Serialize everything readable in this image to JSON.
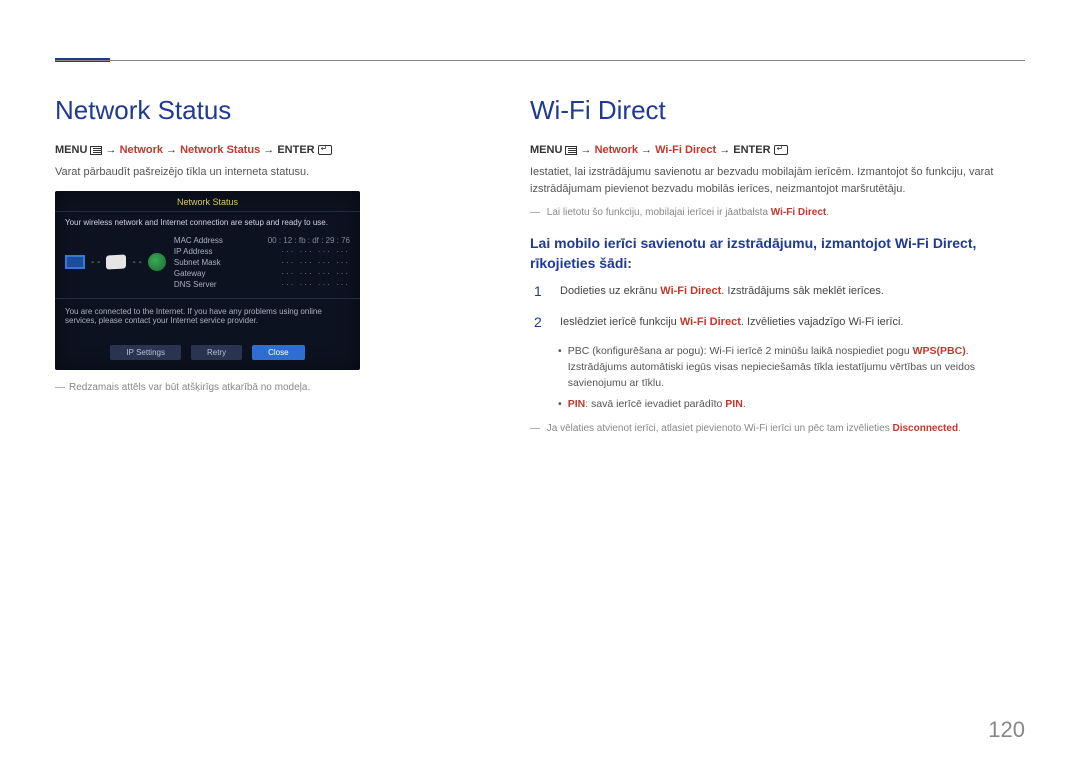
{
  "page_number": "120",
  "left": {
    "heading": "Network Status",
    "menu": {
      "prefix": "MENU",
      "path_hl": "Network",
      "sep1": "→",
      "path_hl2": "Network Status",
      "sep2": "→",
      "suffix": "ENTER"
    },
    "desc": "Varat pārbaudīt pašreizējo tīkla un interneta statusu.",
    "screenshot": {
      "title": "Network Status",
      "msg": "Your wireless network and Internet connection are setup and ready to use.",
      "rows": [
        {
          "k": "MAC Address",
          "v": "00 : 12 : fb : df : 29 : 76"
        },
        {
          "k": "IP Address",
          "v": "···   ···   ···   ···"
        },
        {
          "k": "Subnet Mask",
          "v": "···   ···   ···   ···"
        },
        {
          "k": "Gateway",
          "v": "···   ···   ···   ···"
        },
        {
          "k": "DNS Server",
          "v": "···   ···   ···   ···"
        }
      ],
      "foot": "You are connected to the Internet. If you have any problems using online services, please contact your Internet service provider.",
      "btn1": "IP Settings",
      "btn2": "Retry",
      "btn3": "Close"
    },
    "img_note": "Redzamais attēls var būt atšķirīgs atkarībā no modeļa."
  },
  "right": {
    "heading": "Wi-Fi Direct",
    "menu": {
      "prefix": "MENU",
      "path_hl": "Network",
      "sep1": "→",
      "path_hl2": "Wi-Fi Direct",
      "sep2": "→",
      "suffix": "ENTER"
    },
    "p1": "Iestatiet, lai izstrādājumu savienotu ar bezvadu mobilajām ierīcēm. Izmantojot šo funkciju, varat izstrādājumam pievienot bezvadu mobilās ierīces, neizmantojot maršrutētāju.",
    "note1_a": "Lai lietotu šo funkciju, mobilajai ierīcei ir jāatbalsta ",
    "note1_hl": "Wi-Fi Direct",
    "note1_b": ".",
    "sub": "Lai mobilo ierīci savienotu ar izstrādājumu, izmantojot Wi-Fi Direct, rīkojieties šādi:",
    "step1_a": "Dodieties uz ekrānu ",
    "step1_hl": "Wi-Fi Direct",
    "step1_b": ". Izstrādājums sāk meklēt ierīces.",
    "step2_a": "Ieslēdziet ierīcē funkciju ",
    "step2_hl": "Wi-Fi Direct",
    "step2_b": ". Izvēlieties vajadzīgo Wi-Fi ierīci.",
    "bul1_a": "PBC (konfigurēšana ar pogu): Wi-Fi ierīcē 2 minūšu laikā nospiediet pogu ",
    "bul1_hl": "WPS(PBC)",
    "bul1_b": ". Izstrādājums automātiski iegūs visas nepieciešamās tīkla iestatījumu vērtības un veidos savienojumu ar tīklu.",
    "bul2_hl1": "PIN",
    "bul2_a": ": savā ierīcē ievadiet parādīto ",
    "bul2_hl2": "PIN",
    "bul2_b": ".",
    "note2_a": "Ja vēlaties atvienot ierīci, atlasiet pievienoto Wi-Fi ierīci un pēc tam izvēlieties ",
    "note2_hl": "Disconnected",
    "note2_b": "."
  }
}
